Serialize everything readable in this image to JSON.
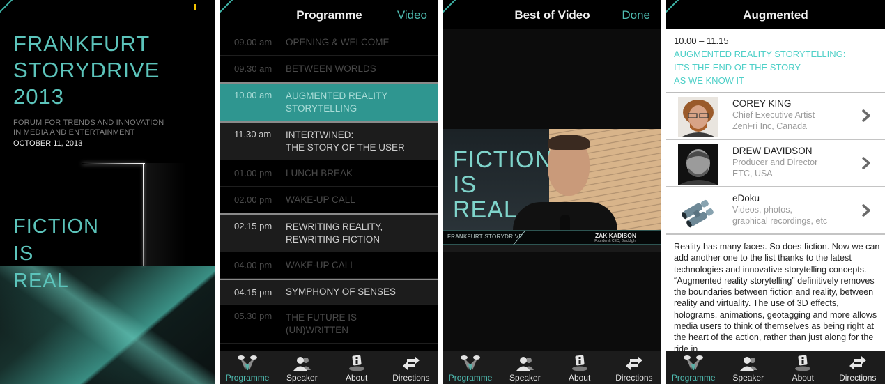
{
  "splash": {
    "title_lines": [
      "FRANKFURT",
      "STORYDRIVE",
      "2013"
    ],
    "subtitle_lines": [
      "FORUM FOR TRENDS AND INNOVATION",
      "IN MEDIA AND ENTERTAINMENT"
    ],
    "date": "OCTOBER 11, 2013",
    "tagline_lines": [
      "FICTION",
      "IS",
      "REAL"
    ]
  },
  "programme": {
    "title": "Programme",
    "right_button": "Video",
    "items": [
      {
        "time": "09.00 am",
        "title": "OPENING & WELCOME",
        "state": "dim"
      },
      {
        "time": "09.30 am",
        "title": "BETWEEN WORLDS",
        "state": "dim"
      },
      {
        "time": "10.00 am",
        "title": "AUGMENTED REALITY\nSTORYTELLING",
        "state": "active"
      },
      {
        "time": "11.30 am",
        "title": "INTERTWINED:\nTHE STORY OF THE USER",
        "state": "bright"
      },
      {
        "time": "01.00 pm",
        "title": "LUNCH BREAK",
        "state": "dim"
      },
      {
        "time": "02.00 pm",
        "title": "WAKE-UP CALL",
        "state": "dim"
      },
      {
        "time": "02.15 pm",
        "title": "REWRITING REALITY,\nREWRITING FICTION",
        "state": "bright"
      },
      {
        "time": "04.00 pm",
        "title": "WAKE-UP CALL",
        "state": "dim"
      },
      {
        "time": "04.15 pm",
        "title": "SYMPHONY OF SENSES",
        "state": "bright"
      },
      {
        "time": "05.30 pm",
        "title": "THE FUTURE IS\n(UN)WRITTEN",
        "state": "dim"
      }
    ]
  },
  "video": {
    "title": "Best of Video",
    "right_button": "Done",
    "slogan_lines": [
      "FICTION",
      "IS",
      "REAL"
    ],
    "lower_third_brand": "FRANKFURT STORYDRIVE",
    "speaker_name": "ZAK KADISON",
    "speaker_role": "Founder & CEO, Blacklight"
  },
  "detail": {
    "title": "Augmented",
    "time": "10.00 – 11.15",
    "session_title": "AUGMENTED REALITY STORYTELLING:\nIT'S THE END OF THE STORY\nAS WE KNOW IT",
    "speakers": [
      {
        "name": "COREY KING",
        "line1": "Chief Executive Artist",
        "line2": "ZenFri Inc, Canada",
        "image": "portrait-red-hair"
      },
      {
        "name": "DREW DAVIDSON",
        "line1": "Producer and Director",
        "line2": "ETC, USA",
        "image": "portrait-bw"
      },
      {
        "name": "eDoku",
        "line1": "Videos, photos,",
        "line2": "graphical recordings, etc",
        "image": "binoculars-icon"
      }
    ],
    "body": "Reality has many faces. So does fiction. Now we can add another one to the list thanks to the latest technologies and innovative storytelling concepts. “Augmented reality storytelling” definitively removes the boundaries between fiction and reality, between reality and virtuality. The use of 3D effects, holograms, animations, geotagging and more allows media users to think of themselves as being right at the heart of the action, rather than just along for the ride in"
  },
  "tabbar": {
    "tabs": [
      {
        "label": "Programme",
        "icon": "spotlights-icon",
        "active": true
      },
      {
        "label": "Speaker",
        "icon": "people-icon",
        "active": false
      },
      {
        "label": "About",
        "icon": "info-icon",
        "active": false
      },
      {
        "label": "Directions",
        "icon": "arrows-icon",
        "active": false
      }
    ]
  },
  "colors": {
    "accent": "#4fbdb2",
    "active_row": "#2f9690",
    "session_title": "#4fd0c8",
    "status_indicator": "#f2c200"
  }
}
